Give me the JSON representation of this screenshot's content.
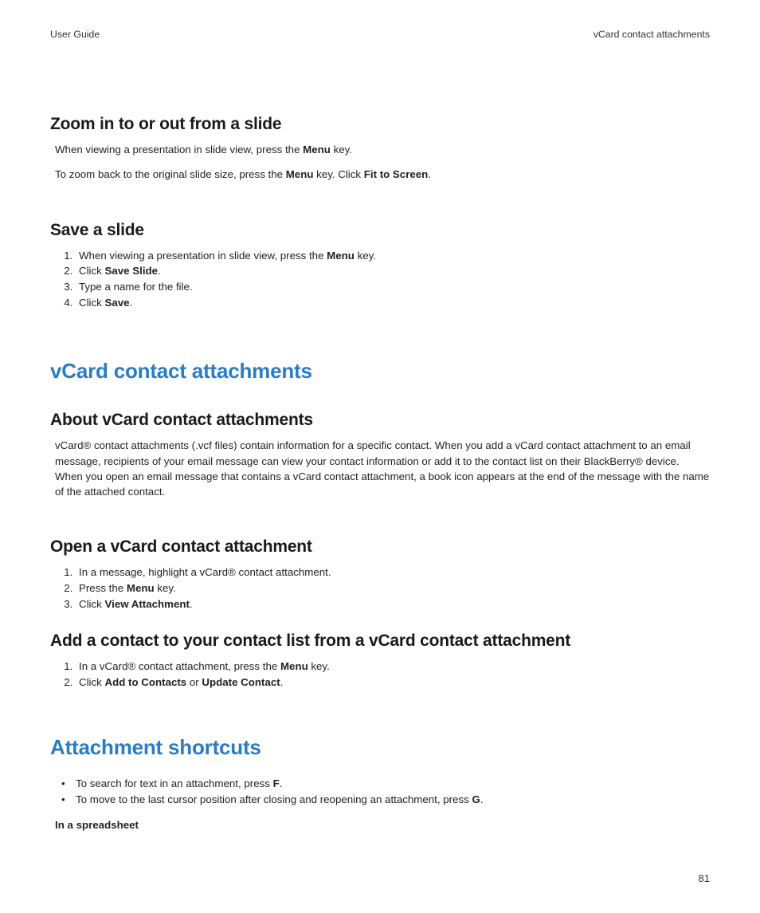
{
  "header": {
    "left": "User Guide",
    "right": "vCard contact attachments"
  },
  "section_zoom": {
    "heading": "Zoom in to or out from a slide",
    "p1_pre": "When viewing a presentation in slide view, press the ",
    "p1_b1": "Menu",
    "p1_post": " key.",
    "p2_pre": "To zoom back to the original slide size, press the ",
    "p2_b1": "Menu",
    "p2_mid": " key. Click ",
    "p2_b2": "Fit to Screen",
    "p2_post": "."
  },
  "section_save": {
    "heading": "Save a slide",
    "s1_pre": "When viewing a presentation in slide view, press the ",
    "s1_b1": "Menu",
    "s1_post": " key.",
    "s2_pre": "Click ",
    "s2_b1": "Save Slide",
    "s2_post": ".",
    "s3": "Type a name for the file.",
    "s4_pre": "Click ",
    "s4_b1": "Save",
    "s4_post": "."
  },
  "major_vcard": "vCard contact attachments",
  "section_about": {
    "heading": "About vCard contact attachments",
    "body": "vCard® contact attachments (.vcf files) contain information for a specific contact. When you add a vCard contact attachment to an email message, recipients of your email message can view your contact information or add it to the contact list on their BlackBerry® device. When you open an email message that contains a vCard contact attachment, a book icon appears at the end of the message with the name of the attached contact."
  },
  "section_open": {
    "heading": "Open a vCard contact attachment",
    "s1": "In a message, highlight a vCard® contact attachment.",
    "s2_pre": "Press the ",
    "s2_b1": "Menu",
    "s2_post": " key.",
    "s3_pre": "Click ",
    "s3_b1": "View Attachment",
    "s3_post": "."
  },
  "section_add": {
    "heading": "Add a contact to your contact list from a vCard contact attachment",
    "s1_pre": "In a vCard® contact attachment, press the ",
    "s1_b1": "Menu",
    "s1_post": " key.",
    "s2_pre": "Click ",
    "s2_b1": "Add to Contacts",
    "s2_mid": " or ",
    "s2_b2": "Update Contact",
    "s2_post": "."
  },
  "major_shortcuts": "Attachment shortcuts",
  "section_shortcuts": {
    "b1_pre": "To search for text in an attachment, press ",
    "b1_b1": "F",
    "b1_post": ".",
    "b2_pre": "To move to the last cursor position after closing and reopening an attachment, press ",
    "b2_b1": "G",
    "b2_post": ".",
    "sublabel": "In a spreadsheet"
  },
  "page_number": "81"
}
